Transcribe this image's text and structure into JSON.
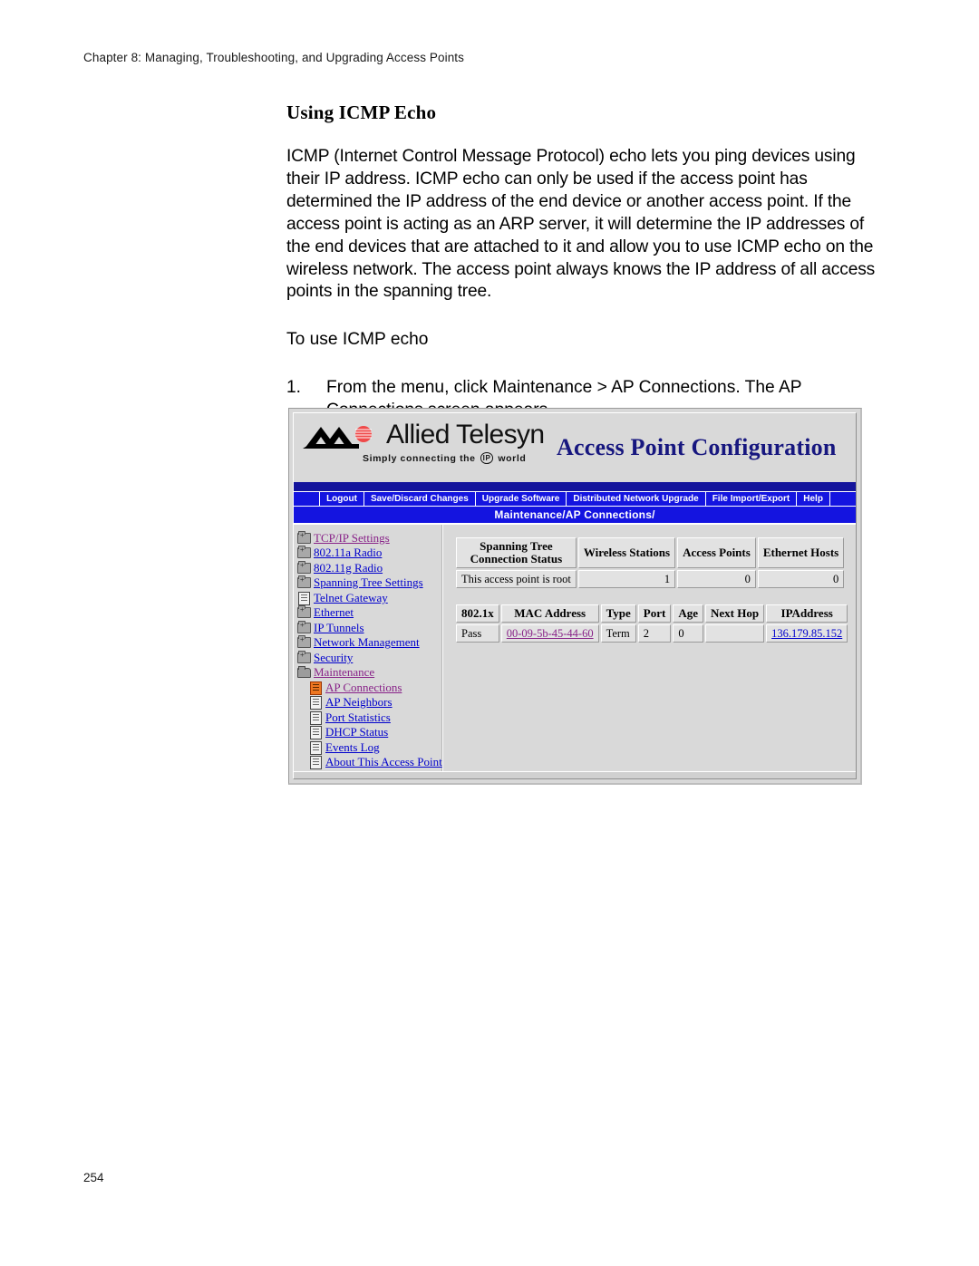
{
  "page": {
    "running_head": "Chapter 8: Managing, Troubleshooting, and Upgrading Access Points",
    "folio": "254",
    "section_title": "Using ICMP Echo",
    "paragraph": "ICMP (Internet Control Message Protocol) echo lets you ping devices using their IP address. ICMP echo can only be used if the access point has determined the IP address of the end device or another access point. If the access point is acting as an ARP server, it will determine the IP addresses of the end devices that are attached to it and allow you to use ICMP echo on the wireless network. The access point always knows the IP address of all access points in the spanning tree.",
    "lead_in": "To use ICMP echo",
    "step_number": "1.",
    "step_text": "From the menu, click Maintenance > AP Connections. The AP Connections screen appears."
  },
  "screenshot": {
    "brand": {
      "name": "Allied Telesyn",
      "tagline_before": "Simply connecting the",
      "tagline_badge": "IP",
      "tagline_after": "world"
    },
    "title": "Access Point Configuration",
    "menu": [
      "Logout",
      "Save/Discard Changes",
      "Upgrade Software",
      "Distributed Network Upgrade",
      "File Import/Export",
      "Help"
    ],
    "breadcrumb": "Maintenance/AP Connections/",
    "tree": [
      {
        "label": "TCP/IP Settings",
        "icon": "folder-closed-icon",
        "link": "visited",
        "indent": false
      },
      {
        "label": "802.11a Radio",
        "icon": "folder-closed-icon",
        "link": "unvisited",
        "indent": false
      },
      {
        "label": "802.11g Radio",
        "icon": "folder-closed-icon",
        "link": "unvisited",
        "indent": false
      },
      {
        "label": "Spanning Tree Settings",
        "icon": "folder-closed-icon",
        "link": "unvisited",
        "indent": false
      },
      {
        "label": "Telnet Gateway",
        "icon": "document-icon",
        "link": "unvisited",
        "indent": false
      },
      {
        "label": "Ethernet",
        "icon": "folder-closed-icon",
        "link": "unvisited",
        "indent": false
      },
      {
        "label": "IP Tunnels",
        "icon": "folder-closed-icon",
        "link": "unvisited",
        "indent": false
      },
      {
        "label": "Network Management",
        "icon": "folder-closed-icon",
        "link": "unvisited",
        "indent": false
      },
      {
        "label": "Security",
        "icon": "folder-closed-icon",
        "link": "unvisited",
        "indent": false
      },
      {
        "label": "Maintenance",
        "icon": "folder-open-icon",
        "link": "visited",
        "indent": false
      },
      {
        "label": "AP Connections",
        "icon": "document-selected-icon",
        "link": "visited",
        "indent": true
      },
      {
        "label": "AP Neighbors",
        "icon": "document-icon",
        "link": "unvisited",
        "indent": true
      },
      {
        "label": "Port Statistics",
        "icon": "document-icon",
        "link": "unvisited",
        "indent": true
      },
      {
        "label": "DHCP Status",
        "icon": "document-icon",
        "link": "unvisited",
        "indent": true
      },
      {
        "label": "Events Log",
        "icon": "document-icon",
        "link": "unvisited",
        "indent": true
      },
      {
        "label": "About This Access Point",
        "icon": "document-icon",
        "link": "unvisited",
        "indent": true
      }
    ],
    "summary_table": {
      "headers": [
        "Spanning Tree Connection Status",
        "Wireless Stations",
        "Access Points",
        "Ethernet Hosts"
      ],
      "header_line1": "Spanning Tree",
      "header_line2": "Connection Status",
      "row": [
        "This access point is root",
        "1",
        "0",
        "0"
      ]
    },
    "connections_table": {
      "headers": [
        "802.1x",
        "MAC Address",
        "Type",
        "Port",
        "Age",
        "Next Hop",
        "IPAddress"
      ],
      "row": {
        "dot1x": "Pass",
        "mac": "00-09-5b-45-44-60",
        "type": "Term",
        "port": "2",
        "age": "0",
        "next_hop": "",
        "ip": "136.179.85.152"
      }
    },
    "colors": {
      "menu_blue": "#1414e0",
      "header_navy": "#14149c",
      "title_navy": "#17177f",
      "link_blue": "#0000cc",
      "link_visited": "#882288",
      "selected_icon": "#ee7722",
      "chrome_gray": "#d9d9d9"
    }
  }
}
